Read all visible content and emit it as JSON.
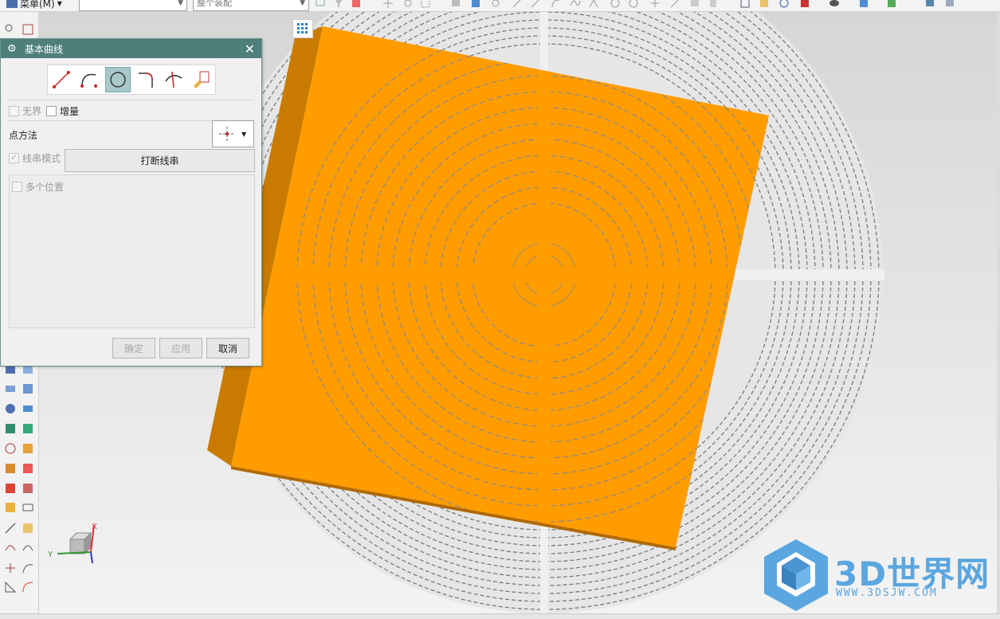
{
  "toolbar": {
    "menu_label": "菜单(M)",
    "filter_combo_value": "",
    "scope_combo_value": "整个装配"
  },
  "dialog": {
    "title": "基本曲线",
    "curve_types": [
      "line-icon",
      "arc-icon",
      "circle-icon",
      "fillet-icon",
      "trim-icon",
      "edit-fillet-icon"
    ],
    "active_curve_type": "circle-icon",
    "unbounded_label": "无界",
    "incremental_label": "增量",
    "point_method_label": "点方法",
    "string_mode_label": "线串模式",
    "break_string_label": "打断线串",
    "multi_position_label": "多个位置",
    "ok_label": "确定",
    "apply_label": "应用",
    "cancel_label": "取消"
  },
  "triad": {
    "x_label": "X",
    "y_label": "Y"
  },
  "watermark": {
    "title": "3D世界网",
    "url": "WWW.3DSJW.COM"
  },
  "colors": {
    "model": "#ff9c00",
    "dialog_header": "#4e7f7b",
    "grid_lines": "#7a7a7a",
    "watermark": "#5aa6e0"
  }
}
